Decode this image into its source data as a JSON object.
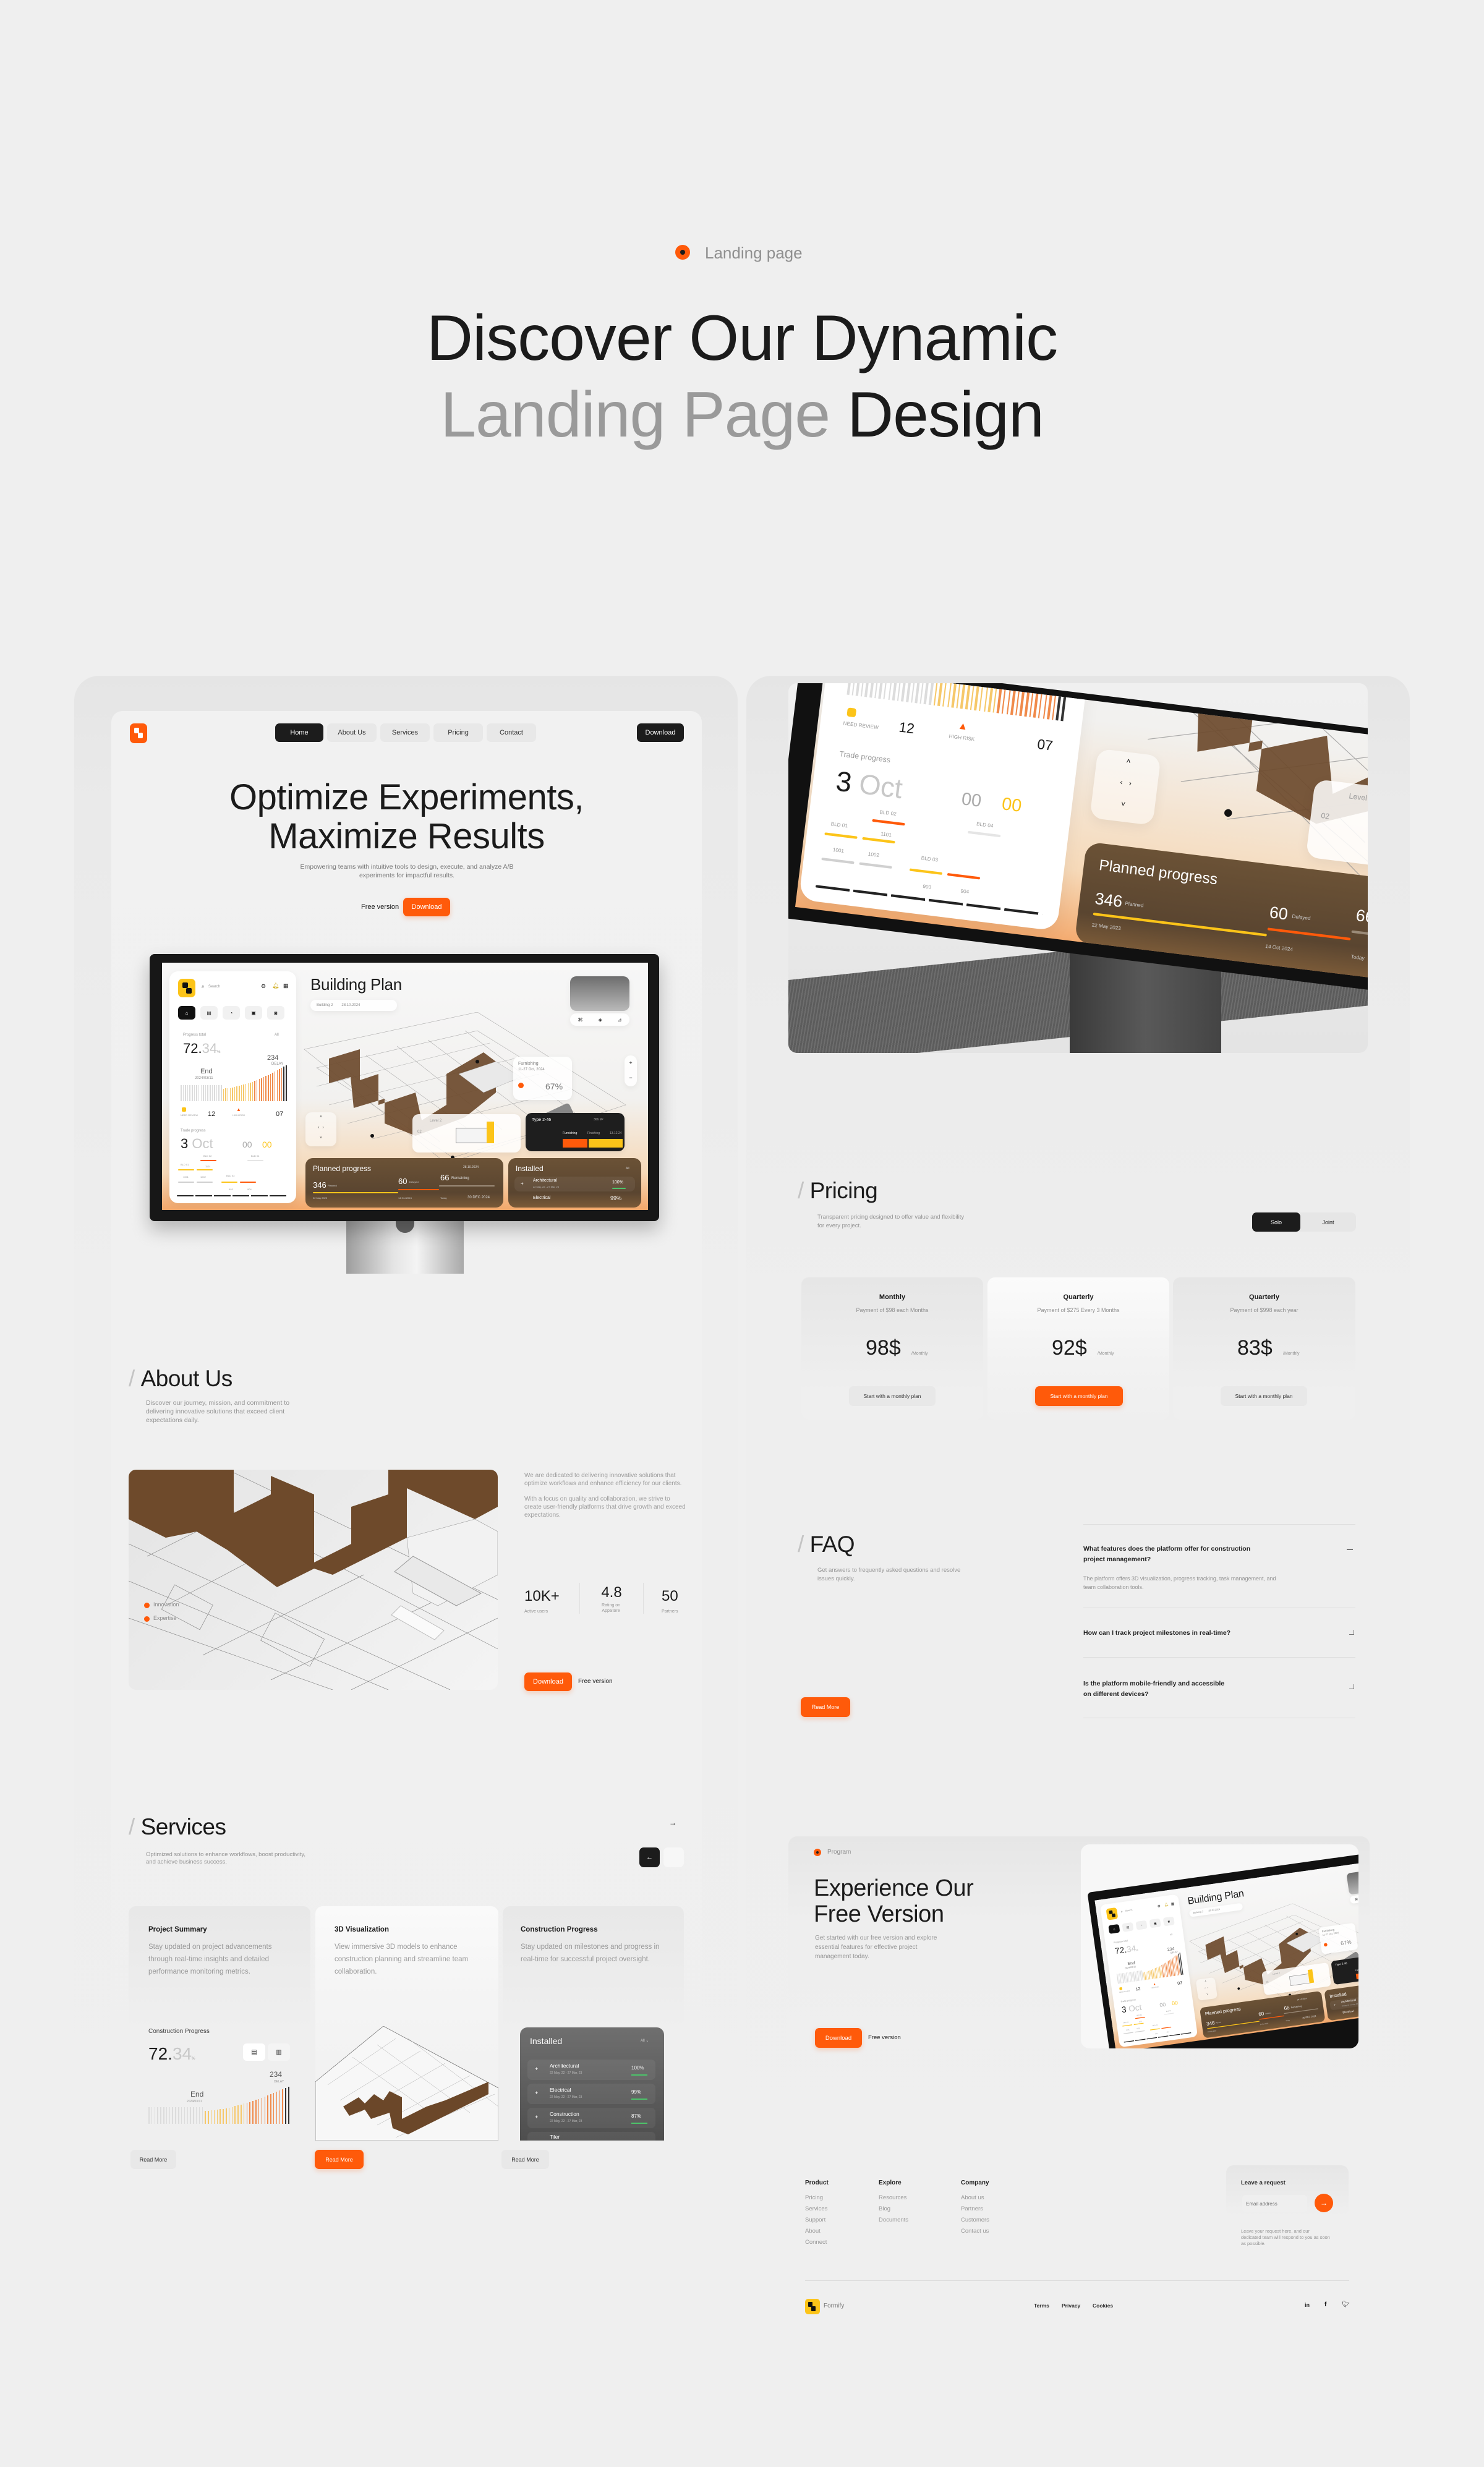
{
  "colors": {
    "accent": "#ff5a0a",
    "dark": "#1c1c1c",
    "brand_yellow": "#fcc419",
    "background": "#efefef"
  },
  "header": {
    "tag": "Landing page",
    "title_line1": "Discover Our Dynamic",
    "title_line2_muted": "Landing Page",
    "title_line2_strong": "Design"
  },
  "site": {
    "nav": {
      "items": [
        "Home",
        "About Us",
        "Services",
        "Pricing",
        "Contact"
      ],
      "active": "Home",
      "download": "Download"
    },
    "hero": {
      "title_line1": "Optimize Experiments,",
      "title_line2": "Maximize Results",
      "subtitle": "Empowering teams with intuitive tools to design, execute, and analyze A/B experiments for impactful results.",
      "secondary": "Free version",
      "primary": "Download"
    },
    "about": {
      "title": "About Us",
      "desc": "Discover our journey, mission, and commitment to delivering innovative solutions that exceed client expectations daily.",
      "legend": [
        "Innovation",
        "Expertise"
      ],
      "para1": "We are dedicated to delivering innovative solutions that optimize workflows and enhance efficiency for our clients.",
      "para2": "With a focus on quality and collaboration, we strive to create user-friendly platforms that drive growth and exceed expectations.",
      "stats": [
        {
          "value": "10K+",
          "label": "Active users"
        },
        {
          "value": "4.8",
          "label": "Rating on AppStore"
        },
        {
          "value": "50",
          "label": "Partners"
        }
      ],
      "primary": "Download",
      "secondary": "Free version"
    },
    "services": {
      "title": "Services",
      "desc": "Optimized solutions to enhance workflows, boost productivity, and achieve business success.",
      "cards": [
        {
          "title": "Project Summary",
          "desc": "Stay updated on project advancements through real-time insights and detailed performance monitoring metrics.",
          "cta": "Read More"
        },
        {
          "title": "3D Visualization",
          "desc": "View immersive 3D models to enhance construction planning and streamline team collaboration.",
          "cta": "Read More"
        },
        {
          "title": "Construction Progress",
          "desc": "Stay updated on milestones and progress in real-time for successful project oversight.",
          "cta": "Read More"
        }
      ],
      "chart": {
        "label": "Construction Progress",
        "value_int": "72.",
        "value_dec": "34",
        "unit": "%",
        "peak": "234",
        "peak_label": "DELAY",
        "end_label": "End",
        "end_date": "2024/03/11"
      },
      "installed": {
        "title": "Installed",
        "filter": "All",
        "items": [
          {
            "name": "Architectural",
            "dates": "22 May, 22 - 27 Mar, 23",
            "pct": "100%"
          },
          {
            "name": "Electrical",
            "dates": "22 May, 22 - 27 Mar, 23",
            "pct": "99%"
          },
          {
            "name": "Construction",
            "dates": "22 May, 22 - 27 Mar, 23",
            "pct": "87%"
          },
          {
            "name": "Tiler",
            "dates": "",
            "pct": ""
          }
        ]
      }
    },
    "pricing": {
      "title": "Pricing",
      "desc": "Transparent pricing designed to offer value and flexibility for every project.",
      "toggle": [
        "Solo",
        "Joint"
      ],
      "toggle_selected": "Solo",
      "plans": [
        {
          "name": "Monthly",
          "note": "Payment of $98 each Months",
          "price": "98$",
          "period": "/Monthly",
          "cta": "Start with a monthly plan",
          "highlighted": false
        },
        {
          "name": "Quarterly",
          "note": "Payment of $275 Every 3 Months",
          "price": "92$",
          "period": "/Monthly",
          "cta": "Start with a monthly plan",
          "highlighted": true
        },
        {
          "name": "Quarterly",
          "note": "Payment of $998 each year",
          "price": "83$",
          "period": "/Monthly",
          "cta": "Start with a monthly plan",
          "highlighted": false
        }
      ]
    },
    "faq": {
      "title": "FAQ",
      "desc": "Get answers to frequently asked questions and resolve issues quickly.",
      "cta": "Read More",
      "items": [
        {
          "q": "What features does the platform offer for construction project management?",
          "a": "The platform offers 3D visualization, progress tracking, task management, and team collaboration tools.",
          "open": true
        },
        {
          "q": "How can I track project milestones in real-time?",
          "a": "",
          "open": false
        },
        {
          "q": "Is the platform mobile-friendly and accessible on different devices?",
          "a": "",
          "open": false
        }
      ]
    },
    "cta": {
      "tag": "Program",
      "title_line1": "Experience Our",
      "title_line2": "Free Version",
      "desc": "Get started with our free version and explore essential features for effective project management today.",
      "primary": "Download",
      "secondary": "Free version"
    },
    "footer": {
      "columns": [
        {
          "title": "Product",
          "items": [
            "Pricing",
            "Services",
            "Support",
            "About",
            "Connect"
          ]
        },
        {
          "title": "Explore",
          "items": [
            "Resources",
            "Blog",
            "Documents"
          ]
        },
        {
          "title": "Company",
          "items": [
            "About us",
            "Partners",
            "Customers",
            "Contact us"
          ]
        }
      ],
      "request": {
        "title": "Leave a request",
        "placeholder": "Email address",
        "note": "Leave your request here, and our dedicated team will respond to you as soon as possible."
      },
      "brand": "Formify",
      "legal": [
        "Terms",
        "Privacy",
        "Cookies"
      ],
      "social": [
        "linkedin-icon",
        "facebook-icon",
        "twitter-icon"
      ]
    }
  },
  "dashboard": {
    "search_placeholder": "Search",
    "title": "Building Plan",
    "chips": [
      "Building 2",
      "28.10.2024"
    ],
    "progress_label": "Progress total",
    "progress_int": "72.",
    "progress_dec": "34",
    "unit": "%",
    "filter": "All",
    "delay_value": "234",
    "delay_label": "DELAY",
    "end_label": "End",
    "end_date": "2024/03/11",
    "need_review": "NEED REVIEW",
    "need_review_count": "12",
    "high_risk": "HIGH RISK",
    "high_risk_count": "07",
    "trade_label": "Trade progress",
    "trade_day": "3",
    "trade_month": "Oct",
    "trade_counter_a": "00",
    "trade_counter_b": "00",
    "blds": [
      "BLD 01",
      "BLD 02",
      "BLD 03",
      "BLD 04"
    ],
    "units": [
      "1001",
      "1002",
      "1101",
      "903",
      "904"
    ],
    "furnishing": {
      "label": "Furnishing",
      "date": "11-27 Oct, 2024",
      "value": "67%"
    },
    "level": {
      "label": "Level 2",
      "floor": "02"
    },
    "type": {
      "label": "Type 2-46",
      "area": "366 M²",
      "phases": [
        "Furnishing",
        "Finishing",
        "13.12.24"
      ]
    },
    "planned": {
      "title": "Planned progress",
      "date": "28.10.2024",
      "planned": "346",
      "planned_label": "Planned",
      "delayed": "60",
      "delayed_label": "Delayed",
      "remaining": "66",
      "remaining_label": "Remaining",
      "dates": [
        "22 May 2023",
        "14 Oct 2024",
        "Today",
        "30 DEC 2024"
      ]
    },
    "installed": {
      "title": "Installed",
      "filter": "All",
      "items": [
        {
          "name": "Architectural",
          "dates": "22 May, 22 - 27 Mar, 23",
          "pct": "100%"
        },
        {
          "name": "Electrical",
          "pct": "99%"
        }
      ]
    }
  }
}
